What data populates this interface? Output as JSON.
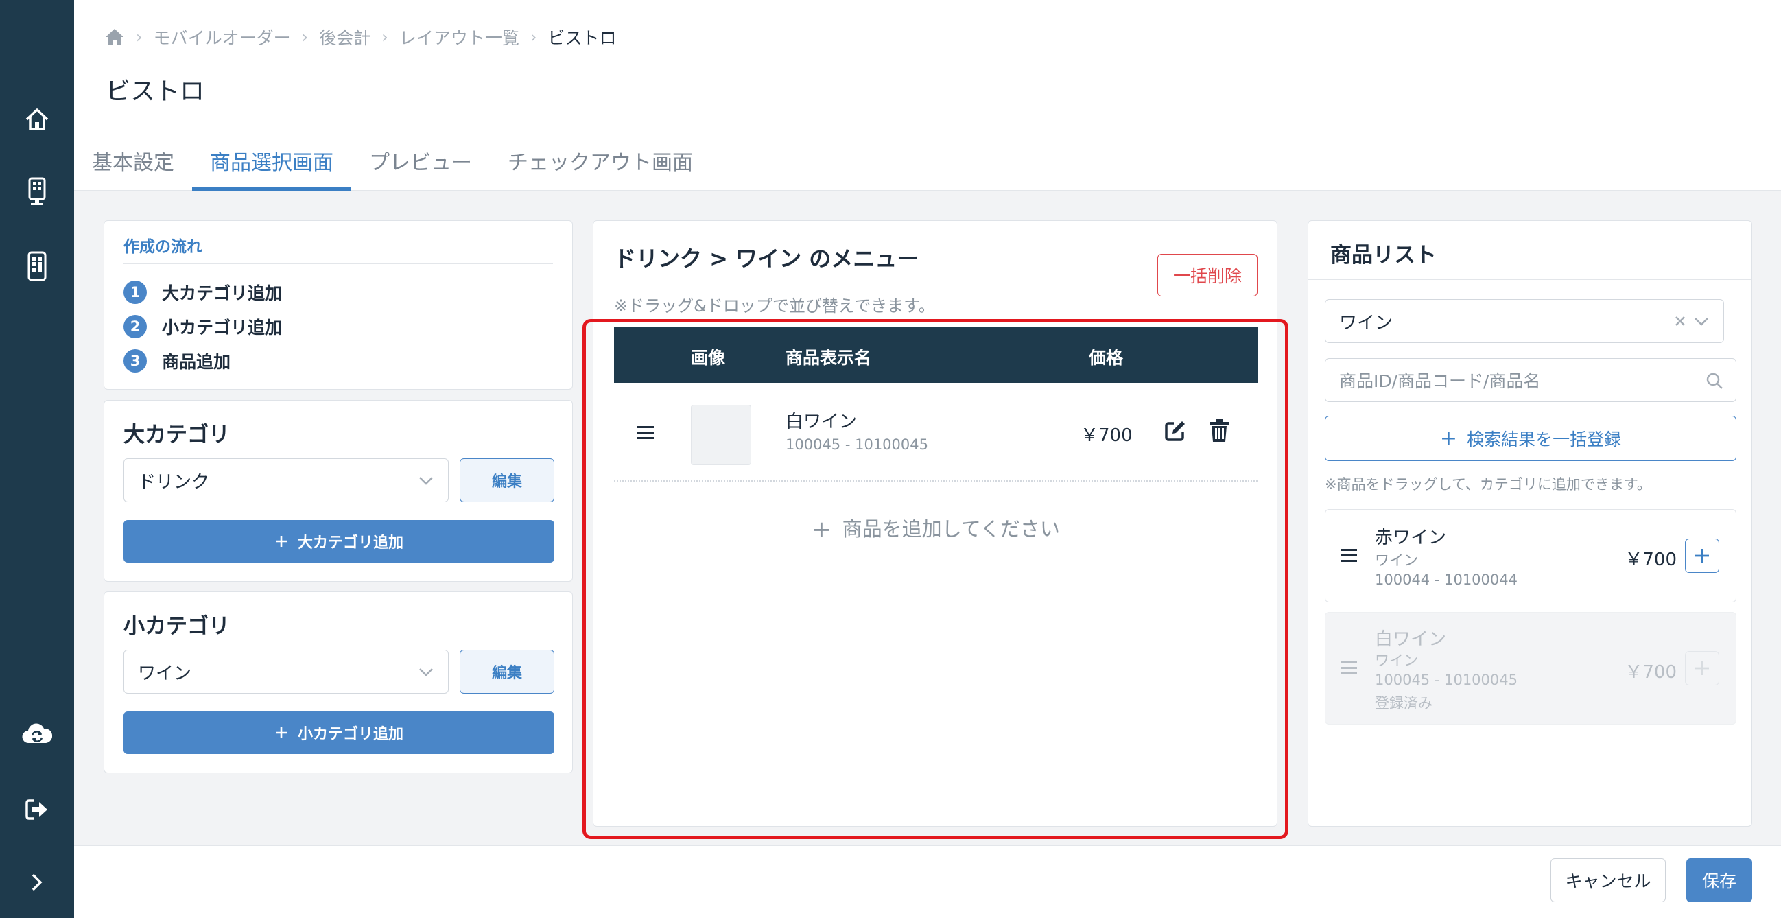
{
  "breadcrumb": {
    "items": [
      "モバイルオーダー",
      "後会計",
      "レイアウト一覧"
    ],
    "current": "ビストロ"
  },
  "page_title": "ビストロ",
  "tabs": [
    "基本設定",
    "商品選択画面",
    "プレビュー",
    "チェックアウト画面"
  ],
  "active_tab": "商品選択画面",
  "flow": {
    "title": "作成の流れ",
    "steps": [
      {
        "num": "1",
        "label": "大カテゴリ追加"
      },
      {
        "num": "2",
        "label": "小カテゴリ追加"
      },
      {
        "num": "3",
        "label": "商品追加"
      }
    ]
  },
  "large_category": {
    "title": "大カテゴリ",
    "selected": "ドリンク",
    "edit_label": "編集",
    "add_label": "大カテゴリ追加"
  },
  "small_category": {
    "title": "小カテゴリ",
    "selected": "ワイン",
    "edit_label": "編集",
    "add_label": "小カテゴリ追加"
  },
  "menu": {
    "title": "ドリンク > ワイン のメニュー",
    "hint": "※ドラッグ&ドロップで並び替えできます。",
    "bulk_delete": "一括削除",
    "columns": {
      "image": "画像",
      "name": "商品表示名",
      "price": "価格"
    },
    "rows": [
      {
        "name": "白ワイン",
        "code": "100045 - 10100045",
        "price": "￥700"
      }
    ],
    "add_product": "商品を追加してください"
  },
  "product_list": {
    "title": "商品リスト",
    "filter_value": "ワイン",
    "search_placeholder": "商品ID/商品コード/商品名",
    "bulk_register": "検索結果を一括登録",
    "hint": "※商品をドラッグして、カテゴリに追加できます。",
    "items": [
      {
        "name": "赤ワイン",
        "category": "ワイン",
        "code": "100044 - 10100044",
        "price": "￥700",
        "status": ""
      },
      {
        "name": "白ワイン",
        "category": "ワイン",
        "code": "100045 - 10100045",
        "price": "￥700",
        "status": "登録済み"
      }
    ]
  },
  "footer": {
    "cancel": "キャンセル",
    "save": "保存"
  },
  "colors": {
    "sidebar": "#1e3a4c",
    "accent": "#4a86c8",
    "danger": "#e0474c",
    "highlight": "#e3181f"
  },
  "icons": [
    "home-icon",
    "kiosk-icon",
    "tablet-icon",
    "cloud-sync-icon",
    "logout-icon",
    "expand-icon",
    "chevron-down-icon",
    "clear-icon",
    "search-icon",
    "drag-handle-icon",
    "edit-icon",
    "trash-icon",
    "plus-icon"
  ]
}
